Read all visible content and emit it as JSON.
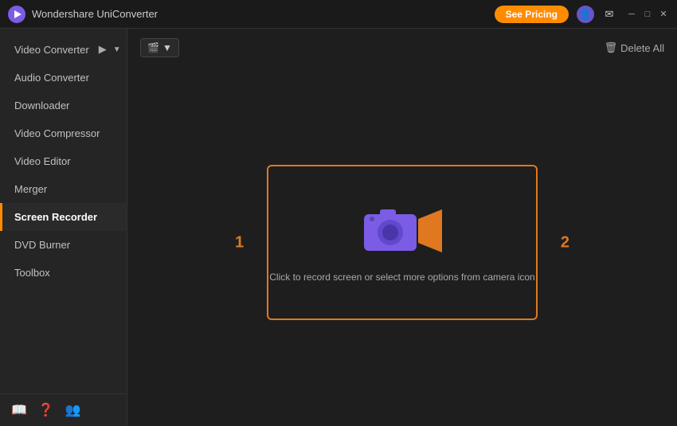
{
  "titleBar": {
    "appName": "Wondershare UniConverter",
    "seePricingLabel": "See Pricing"
  },
  "toolbar": {
    "deleteAllLabel": "Delete All"
  },
  "sidebar": {
    "items": [
      {
        "id": "video-converter",
        "label": "Video Converter",
        "active": false
      },
      {
        "id": "audio-converter",
        "label": "Audio Converter",
        "active": false
      },
      {
        "id": "downloader",
        "label": "Downloader",
        "active": false
      },
      {
        "id": "video-compressor",
        "label": "Video Compressor",
        "active": false
      },
      {
        "id": "video-editor",
        "label": "Video Editor",
        "active": false
      },
      {
        "id": "merger",
        "label": "Merger",
        "active": false
      },
      {
        "id": "screen-recorder",
        "label": "Screen Recorder",
        "active": true
      },
      {
        "id": "dvd-burner",
        "label": "DVD Burner",
        "active": false
      },
      {
        "id": "toolbox",
        "label": "Toolbox",
        "active": false
      }
    ]
  },
  "recordArea": {
    "hint": "Click to record screen or select more options from camera icon",
    "label1": "1",
    "label2": "2"
  },
  "windowControls": {
    "minimizeSymbol": "─",
    "maximizeSymbol": "□",
    "closeSymbol": "✕"
  }
}
